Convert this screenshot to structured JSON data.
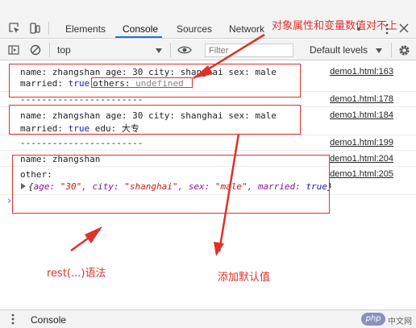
{
  "tabs": [
    {
      "label": "Elements"
    },
    {
      "label": "Console"
    },
    {
      "label": "Sources"
    },
    {
      "label": "Network"
    }
  ],
  "filterbar": {
    "context": "top",
    "filter_placeholder": "Filter",
    "levels": "Default levels"
  },
  "console": [
    {
      "id": "l1a",
      "text": "name: zhangshan age: 30 city: shanghai sex: male",
      "source": "demo1.html:163"
    },
    {
      "id": "l1b_key",
      "text": "married: "
    },
    {
      "id": "l1b_val",
      "text": "true"
    },
    {
      "id": "l1b_others",
      "text": "others: "
    },
    {
      "id": "l1b_undef",
      "text": "undefined"
    },
    {
      "id": "l2",
      "text": "-----------------------",
      "source": "demo1.html:178"
    },
    {
      "id": "l3a",
      "text": "name: zhangshan age: 30 city: shanghai sex: male",
      "source": "demo1.html:184"
    },
    {
      "id": "l3b_key",
      "text": "married: "
    },
    {
      "id": "l3b_val",
      "text": "true"
    },
    {
      "id": "l3b_edu",
      "text": " edu: 大专"
    },
    {
      "id": "l4",
      "text": "-----------------------",
      "source": "demo1.html:199"
    },
    {
      "id": "l5",
      "text": "name: zhangshan",
      "source": "demo1.html:204"
    },
    {
      "id": "l6",
      "text": "other:",
      "source": "demo1.html:205"
    }
  ],
  "object_preview": {
    "open": "{",
    "age_key": "age: ",
    "age_val": "\"30\"",
    "city_key": ", city: ",
    "city_val": "\"shanghai\"",
    "sex_key": ", sex: ",
    "sex_val": "\"male\"",
    "married_key": ", married: ",
    "married_val": "true",
    "close": "}"
  },
  "prompt": "›",
  "annotations": {
    "top": "对象属性和变量数值对不上",
    "rest": "rest(...)语法",
    "default": "添加默认值"
  },
  "drawer": {
    "label": "Console",
    "badge": "php",
    "watermark": "中文网"
  },
  "colors": {
    "annotation": "#e0302a",
    "active_tab": "#1a73e8"
  }
}
